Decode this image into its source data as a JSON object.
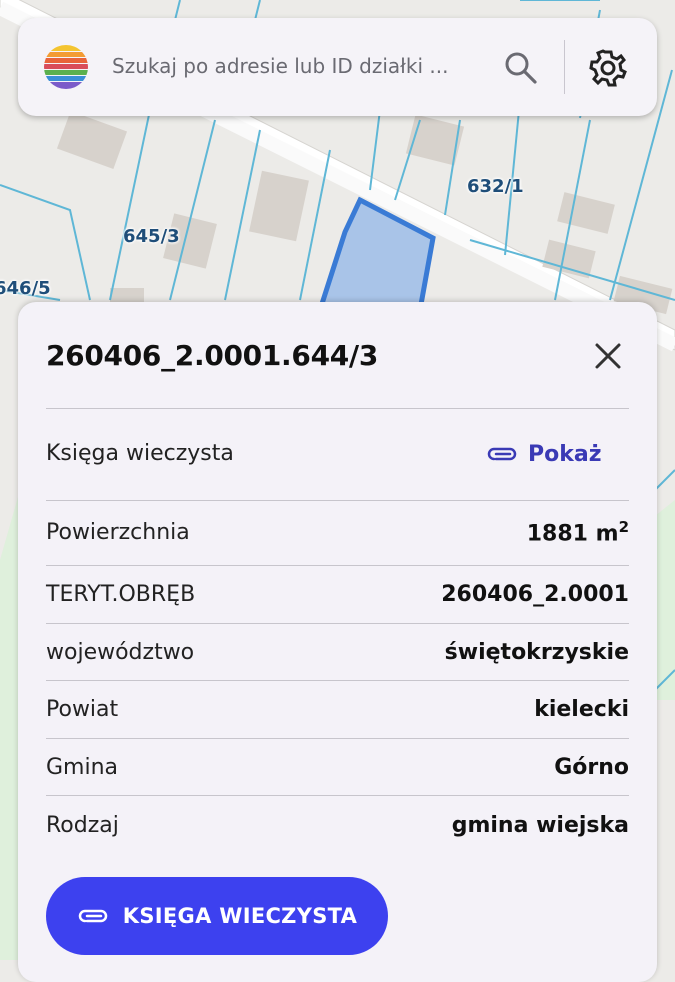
{
  "map": {
    "labels": [
      "632/1",
      "645/3",
      "646/5"
    ],
    "parcel_highlight_color": "#3a7bd5",
    "parcel_line_color": "#5fb7d6"
  },
  "search": {
    "placeholder": "Szukaj po adresie lub ID działki ...",
    "search_icon": "search-icon",
    "settings_icon": "gear-icon"
  },
  "panel": {
    "title": "260406_2.0001.644/3",
    "close_icon": "close-icon",
    "kw_row": {
      "label": "Księga wieczysta",
      "action": "Pokaż",
      "action_icon": "paperclip-icon"
    },
    "rows": [
      {
        "label": "Powierzchnia",
        "value": "1881 m",
        "sup": "2"
      },
      {
        "label": "TERYT.OBRĘB",
        "value": "260406_2.0001"
      },
      {
        "label": "województwo",
        "value": "świętokrzyskie"
      },
      {
        "label": "Powiat",
        "value": "kielecki"
      },
      {
        "label": "Gmina",
        "value": "Górno"
      },
      {
        "label": "Rodzaj",
        "value": "gmina wiejska"
      }
    ],
    "button": {
      "label": "KSIĘGA WIECZYSTA",
      "icon": "paperclip-icon",
      "color": "#3d41ef"
    }
  }
}
